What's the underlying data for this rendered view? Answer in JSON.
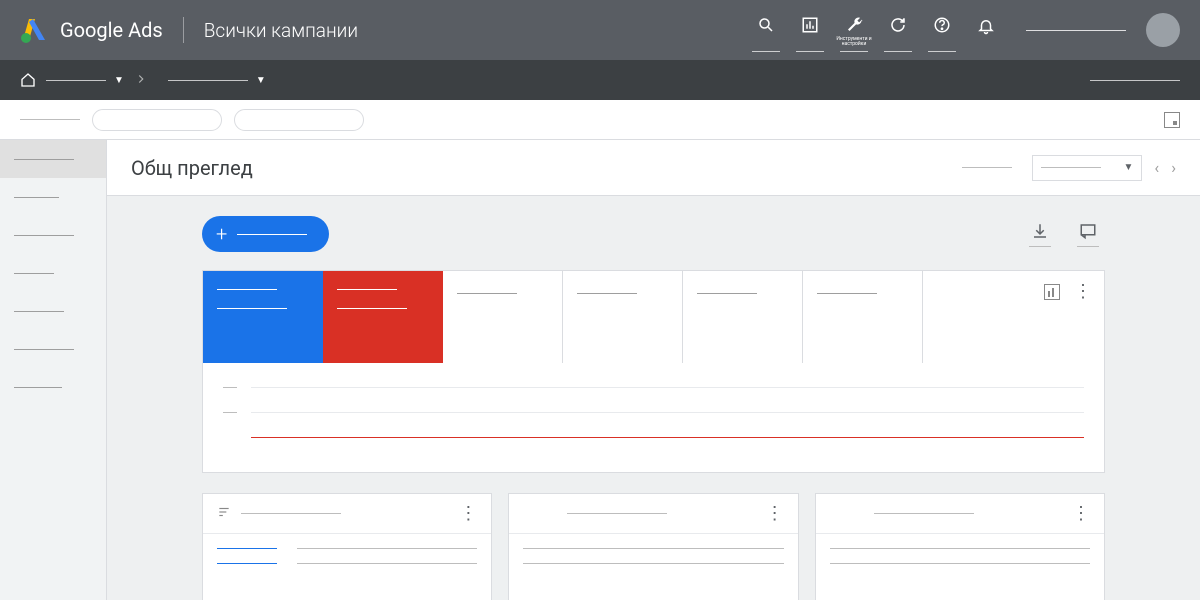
{
  "header": {
    "product": "Google Ads",
    "title": "Всички кампании",
    "tools": {
      "search": "",
      "reports": "",
      "tools": "Инструменти и настройки",
      "refresh": "",
      "help": "",
      "notifications": ""
    }
  },
  "content": {
    "title": "Общ преглед"
  }
}
